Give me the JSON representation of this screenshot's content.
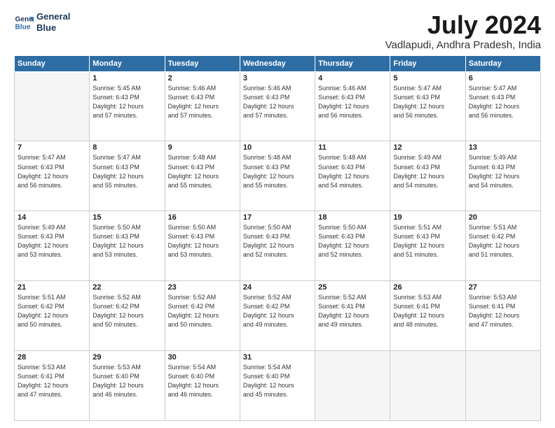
{
  "logo": {
    "line1": "General",
    "line2": "Blue"
  },
  "title": "July 2024",
  "subtitle": "Vadlapudi, Andhra Pradesh, India",
  "days_header": [
    "Sunday",
    "Monday",
    "Tuesday",
    "Wednesday",
    "Thursday",
    "Friday",
    "Saturday"
  ],
  "weeks": [
    [
      {
        "day": "",
        "info": ""
      },
      {
        "day": "1",
        "info": "Sunrise: 5:45 AM\nSunset: 6:43 PM\nDaylight: 12 hours\nand 57 minutes."
      },
      {
        "day": "2",
        "info": "Sunrise: 5:46 AM\nSunset: 6:43 PM\nDaylight: 12 hours\nand 57 minutes."
      },
      {
        "day": "3",
        "info": "Sunrise: 5:46 AM\nSunset: 6:43 PM\nDaylight: 12 hours\nand 57 minutes."
      },
      {
        "day": "4",
        "info": "Sunrise: 5:46 AM\nSunset: 6:43 PM\nDaylight: 12 hours\nand 56 minutes."
      },
      {
        "day": "5",
        "info": "Sunrise: 5:47 AM\nSunset: 6:43 PM\nDaylight: 12 hours\nand 56 minutes."
      },
      {
        "day": "6",
        "info": "Sunrise: 5:47 AM\nSunset: 6:43 PM\nDaylight: 12 hours\nand 56 minutes."
      }
    ],
    [
      {
        "day": "7",
        "info": ""
      },
      {
        "day": "8",
        "info": "Sunrise: 5:47 AM\nSunset: 6:43 PM\nDaylight: 12 hours\nand 55 minutes."
      },
      {
        "day": "9",
        "info": "Sunrise: 5:48 AM\nSunset: 6:43 PM\nDaylight: 12 hours\nand 55 minutes."
      },
      {
        "day": "10",
        "info": "Sunrise: 5:48 AM\nSunset: 6:43 PM\nDaylight: 12 hours\nand 55 minutes."
      },
      {
        "day": "11",
        "info": "Sunrise: 5:48 AM\nSunset: 6:43 PM\nDaylight: 12 hours\nand 54 minutes."
      },
      {
        "day": "12",
        "info": "Sunrise: 5:49 AM\nSunset: 6:43 PM\nDaylight: 12 hours\nand 54 minutes."
      },
      {
        "day": "13",
        "info": "Sunrise: 5:49 AM\nSunset: 6:43 PM\nDaylight: 12 hours\nand 54 minutes."
      }
    ],
    [
      {
        "day": "14",
        "info": ""
      },
      {
        "day": "15",
        "info": "Sunrise: 5:50 AM\nSunset: 6:43 PM\nDaylight: 12 hours\nand 53 minutes."
      },
      {
        "day": "16",
        "info": "Sunrise: 5:50 AM\nSunset: 6:43 PM\nDaylight: 12 hours\nand 53 minutes."
      },
      {
        "day": "17",
        "info": "Sunrise: 5:50 AM\nSunset: 6:43 PM\nDaylight: 12 hours\nand 52 minutes."
      },
      {
        "day": "18",
        "info": "Sunrise: 5:50 AM\nSunset: 6:43 PM\nDaylight: 12 hours\nand 52 minutes."
      },
      {
        "day": "19",
        "info": "Sunrise: 5:51 AM\nSunset: 6:43 PM\nDaylight: 12 hours\nand 51 minutes."
      },
      {
        "day": "20",
        "info": "Sunrise: 5:51 AM\nSunset: 6:42 PM\nDaylight: 12 hours\nand 51 minutes."
      }
    ],
    [
      {
        "day": "21",
        "info": ""
      },
      {
        "day": "22",
        "info": "Sunrise: 5:52 AM\nSunset: 6:42 PM\nDaylight: 12 hours\nand 50 minutes."
      },
      {
        "day": "23",
        "info": "Sunrise: 5:52 AM\nSunset: 6:42 PM\nDaylight: 12 hours\nand 50 minutes."
      },
      {
        "day": "24",
        "info": "Sunrise: 5:52 AM\nSunset: 6:42 PM\nDaylight: 12 hours\nand 49 minutes."
      },
      {
        "day": "25",
        "info": "Sunrise: 5:52 AM\nSunset: 6:41 PM\nDaylight: 12 hours\nand 49 minutes."
      },
      {
        "day": "26",
        "info": "Sunrise: 5:53 AM\nSunset: 6:41 PM\nDaylight: 12 hours\nand 48 minutes."
      },
      {
        "day": "27",
        "info": "Sunrise: 5:53 AM\nSunset: 6:41 PM\nDaylight: 12 hours\nand 47 minutes."
      }
    ],
    [
      {
        "day": "28",
        "info": "Sunrise: 5:53 AM\nSunset: 6:41 PM\nDaylight: 12 hours\nand 47 minutes."
      },
      {
        "day": "29",
        "info": "Sunrise: 5:53 AM\nSunset: 6:40 PM\nDaylight: 12 hours\nand 46 minutes."
      },
      {
        "day": "30",
        "info": "Sunrise: 5:54 AM\nSunset: 6:40 PM\nDaylight: 12 hours\nand 46 minutes."
      },
      {
        "day": "31",
        "info": "Sunrise: 5:54 AM\nSunset: 6:40 PM\nDaylight: 12 hours\nand 45 minutes."
      },
      {
        "day": "",
        "info": ""
      },
      {
        "day": "",
        "info": ""
      },
      {
        "day": "",
        "info": ""
      }
    ]
  ],
  "week7_sunday": {
    "info": "Sunrise: 5:47 AM\nSunset: 6:43 PM\nDaylight: 12 hours\nand 56 minutes."
  },
  "week14_sunday": {
    "info": "Sunrise: 5:49 AM\nSunset: 6:43 PM\nDaylight: 12 hours\nand 53 minutes."
  },
  "week21_sunday": {
    "info": "Sunrise: 5:51 AM\nSunset: 6:42 PM\nDaylight: 12 hours\nand 50 minutes."
  }
}
